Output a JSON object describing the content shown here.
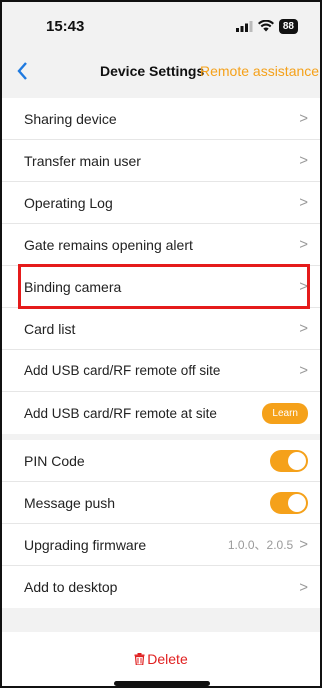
{
  "status_bar": {
    "time": "15:43",
    "battery": "88"
  },
  "nav": {
    "back_icon": "chevron-left-icon",
    "title": "Device Settings",
    "action": "Remote assistance"
  },
  "colors": {
    "accent": "#f5a11a",
    "link": "#1f7ae0",
    "danger": "#e02020",
    "highlight": "#e51b1b"
  },
  "group1": [
    {
      "label": "Sharing device"
    },
    {
      "label": "Transfer main user"
    },
    {
      "label": "Operating Log"
    },
    {
      "label": "Gate remains opening alert"
    },
    {
      "label": "Binding camera"
    },
    {
      "label": "Card list"
    },
    {
      "label": "Add USB card/RF remote off site"
    },
    {
      "label": "Add USB card/RF remote at site",
      "button": "Learn"
    }
  ],
  "group2": {
    "pin_code": {
      "label": "PIN Code",
      "on": true
    },
    "message_push": {
      "label": "Message push",
      "on": true
    },
    "firmware": {
      "label": "Upgrading firmware",
      "value": "1.0.0、2.0.5"
    },
    "desktop": {
      "label": "Add to desktop"
    }
  },
  "delete": {
    "label": "Delete",
    "icon": "trash-icon"
  }
}
